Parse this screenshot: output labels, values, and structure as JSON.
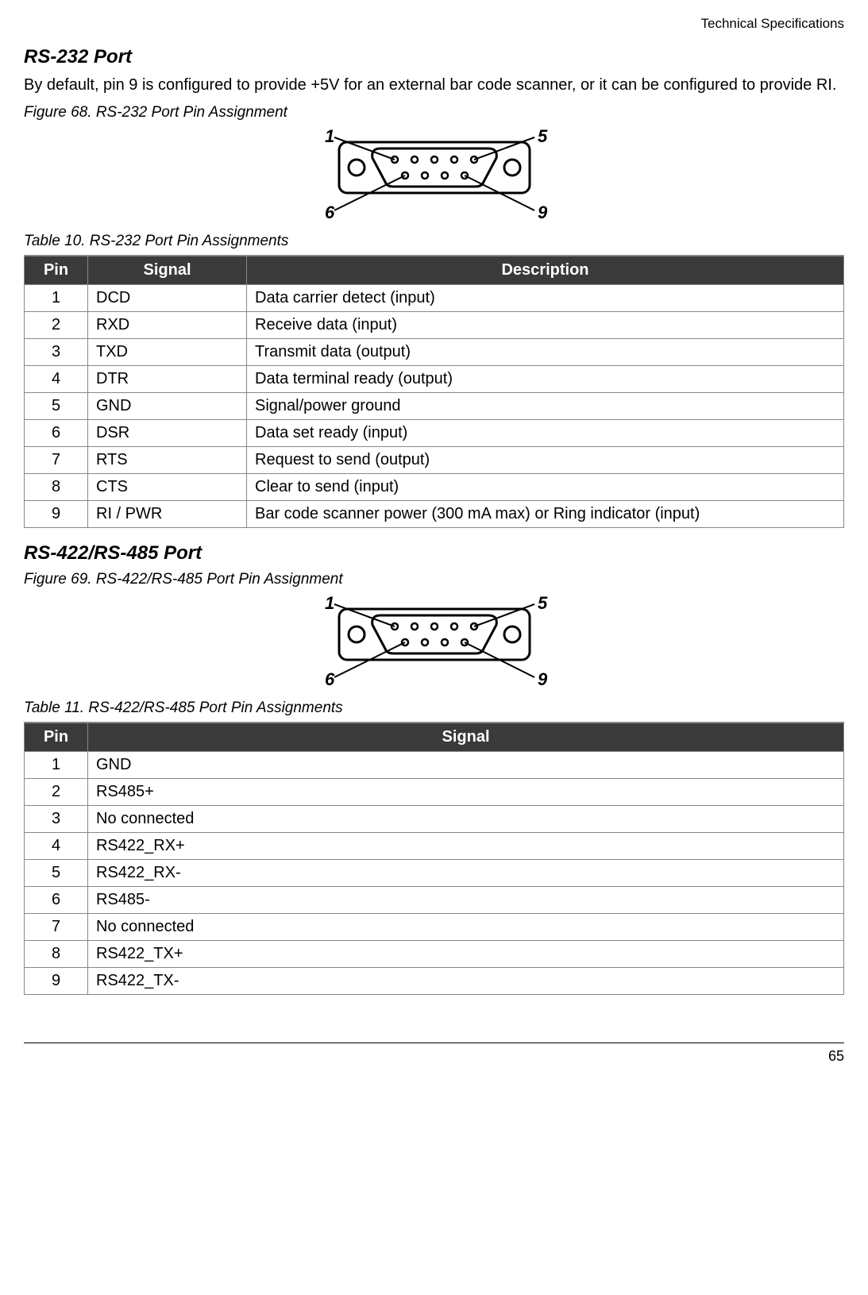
{
  "header": {
    "running_title": "Technical Specifications"
  },
  "section1": {
    "title": "RS-232 Port",
    "paragraph": "By default, pin 9 is configured to provide +5V for an external bar code scanner, or it can be configured to provide RI.",
    "figure_caption": "Figure 68.   RS-232 Port Pin Assignment",
    "figure_labels": {
      "tl": "1",
      "tr": "5",
      "bl": "6",
      "br": "9"
    },
    "table_caption": "Table 10.   RS-232 Port Pin Assignments",
    "table_headers": {
      "pin": "Pin",
      "signal": "Signal",
      "desc": "Description"
    },
    "rows": [
      {
        "pin": "1",
        "signal": "DCD",
        "desc": "Data carrier detect (input)"
      },
      {
        "pin": "2",
        "signal": "RXD",
        "desc": "Receive data (input)"
      },
      {
        "pin": "3",
        "signal": "TXD",
        "desc": "Transmit data (output)"
      },
      {
        "pin": "4",
        "signal": "DTR",
        "desc": "Data terminal ready (output)"
      },
      {
        "pin": "5",
        "signal": "GND",
        "desc": "Signal/power ground"
      },
      {
        "pin": "6",
        "signal": "DSR",
        "desc": "Data set ready (input)"
      },
      {
        "pin": "7",
        "signal": "RTS",
        "desc": "Request to send (output)"
      },
      {
        "pin": "8",
        "signal": "CTS",
        "desc": "Clear to send (input)"
      },
      {
        "pin": "9",
        "signal": "RI / PWR",
        "desc": "Bar code scanner power (300 mA max) or Ring indicator (input)"
      }
    ]
  },
  "section2": {
    "title": "RS-422/RS-485 Port",
    "figure_caption": "Figure 69.   RS-422/RS-485 Port Pin Assignment",
    "figure_labels": {
      "tl": "1",
      "tr": "5",
      "bl": "6",
      "br": "9"
    },
    "table_caption": "Table 11.   RS-422/RS-485 Port Pin Assignments",
    "table_headers": {
      "pin": "Pin",
      "signal": "Signal"
    },
    "rows": [
      {
        "pin": "1",
        "signal": "GND"
      },
      {
        "pin": "2",
        "signal": "RS485+"
      },
      {
        "pin": "3",
        "signal": "No connected"
      },
      {
        "pin": "4",
        "signal": "RS422_RX+"
      },
      {
        "pin": "5",
        "signal": "RS422_RX-"
      },
      {
        "pin": "6",
        "signal": "RS485-"
      },
      {
        "pin": "7",
        "signal": "No connected"
      },
      {
        "pin": "8",
        "signal": "RS422_TX+"
      },
      {
        "pin": "9",
        "signal": "RS422_TX-"
      }
    ]
  },
  "footer": {
    "page_number": "65"
  }
}
